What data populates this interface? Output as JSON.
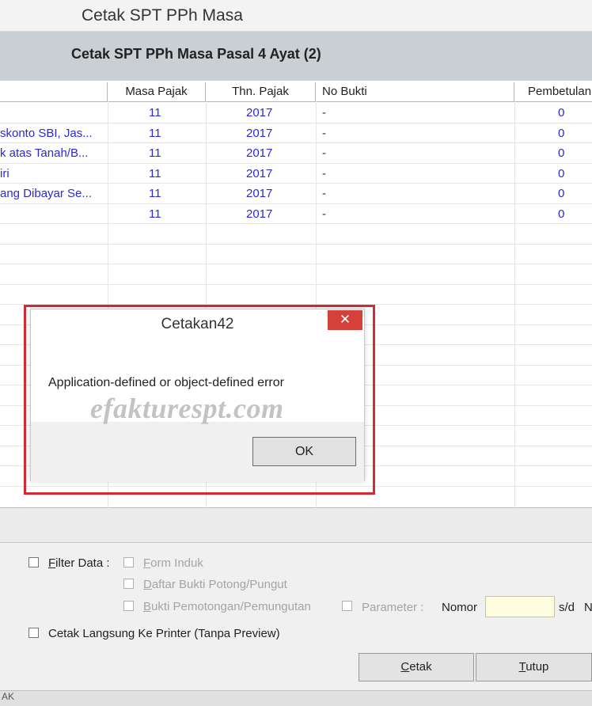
{
  "window": {
    "title": "Cetak SPT PPh Masa"
  },
  "header": {
    "title": "Cetak SPT PPh Masa Pasal 4 Ayat (2)"
  },
  "table": {
    "columns": [
      "Masa Pajak",
      "Thn. Pajak",
      "No Bukti",
      "Pembetulan"
    ],
    "rows": [
      {
        "name": "",
        "masa": "11",
        "tahun": "2017",
        "bukti": "-",
        "pembetulan": "0"
      },
      {
        "name": "skonto SBI, Jas...",
        "masa": "11",
        "tahun": "2017",
        "bukti": "-",
        "pembetulan": "0"
      },
      {
        "name": "k atas Tanah/B...",
        "masa": "11",
        "tahun": "2017",
        "bukti": "-",
        "pembetulan": "0"
      },
      {
        "name": "iri",
        "masa": "11",
        "tahun": "2017",
        "bukti": "-",
        "pembetulan": "0"
      },
      {
        "name": "ang Dibayar Se...",
        "masa": "11",
        "tahun": "2017",
        "bukti": "-",
        "pembetulan": "0"
      },
      {
        "name": "",
        "masa": "11",
        "tahun": "2017",
        "bukti": "-",
        "pembetulan": "0"
      }
    ]
  },
  "dialog": {
    "title": "Cetakan42",
    "close": "✕",
    "message": "Application-defined or object-defined error",
    "ok_label": "OK"
  },
  "watermark": "efakturespt.com",
  "filters": {
    "filter_prefix": "F",
    "filter_rest": "ilter Data :",
    "form_prefix": "F",
    "form_rest": "orm Induk",
    "daftar_prefix": "D",
    "daftar_rest": "aftar Bukti Potong/Pungut",
    "bukti_prefix": "B",
    "bukti_rest": "ukti Pemotongan/Pemungutan",
    "parameter": "Parameter :",
    "nomor": "Nomor",
    "sd": "s/d",
    "n": "N",
    "cetak_langsung": "Cetak Langsung Ke Printer (Tanpa Preview)"
  },
  "buttons": {
    "cetak_prefix": "C",
    "cetak_rest": "etak",
    "tutup_prefix": "T",
    "tutup_rest": "utup"
  },
  "statusbar": {
    "text": "AK"
  },
  "colors": {
    "highlight": "#d42a35",
    "row_text": "#2a2ad0",
    "close_button": "#d6403a",
    "header_bg": "#c9cfd2"
  }
}
